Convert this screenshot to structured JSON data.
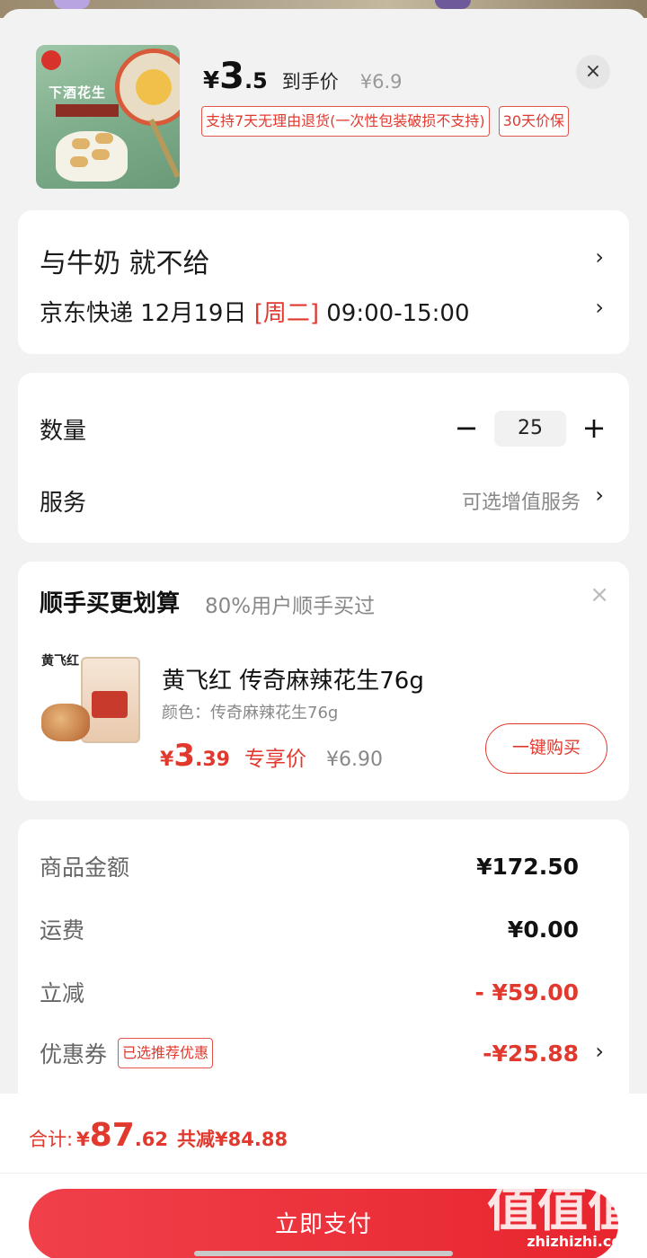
{
  "product": {
    "currency": "¥",
    "price_int": "3",
    "price_dec": ".5",
    "price_label": "到手价",
    "orig_price": "¥6.9",
    "tags": [
      "支持7天无理由退货(一次性包装破损不支持)",
      "30天价保"
    ],
    "image_text": "下酒花生",
    "close_icon": "×"
  },
  "address": {
    "name": "与牛奶  就不给",
    "carrier_date": "京东快递 12月19日 ",
    "weekday": "[周二]",
    "time_window": " 09:00-15:00",
    "chevron": "›"
  },
  "quantity": {
    "label": "数量",
    "minus": "−",
    "value": "25",
    "plus": "+",
    "service_label": "服务",
    "service_value": "可选增值服务"
  },
  "recommend": {
    "title": "顺手买更划算",
    "subtitle": "80%用户顺手买过",
    "close_icon": "×",
    "item": {
      "image_text": "黄飞红",
      "name": "黄飞红 传奇麻辣花生76g",
      "spec": "颜色：传奇麻辣花生76g",
      "currency": "¥",
      "price_int": "3",
      "price_dec": ".39",
      "price_tag": "专享价",
      "orig_price": "¥6.90",
      "buy_label": "一键购买"
    }
  },
  "summary": {
    "rows": [
      {
        "label": "商品金额",
        "value": "¥172.50"
      },
      {
        "label": "运费",
        "value": "¥0.00"
      },
      {
        "label": "立减",
        "value": "- ¥59.00"
      },
      {
        "label": "优惠券",
        "value": "-¥25.88",
        "tag": "已选推荐优惠"
      }
    ]
  },
  "footer": {
    "total_label": "合计:",
    "currency": "¥",
    "total_int": "87",
    "total_dec": ".62",
    "saved": "共减¥84.88",
    "pay_label": "立即支付",
    "watermark": "值值值",
    "watermark_sub": "zhizhizhi.com"
  },
  "colors": {
    "accent": "#e2392f",
    "background": "#f2f2f2"
  }
}
